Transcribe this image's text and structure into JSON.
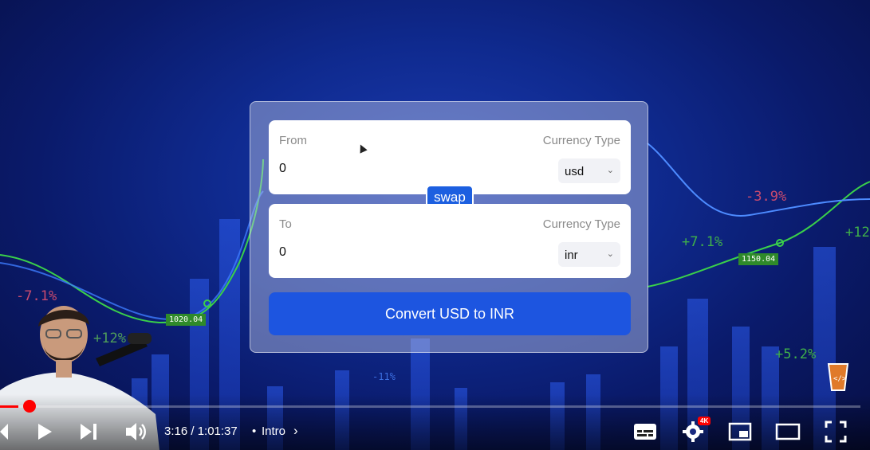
{
  "converter": {
    "from_label": "From",
    "from_currency_label": "Currency Type",
    "from_amount": "0",
    "from_currency": "usd",
    "swap_label": "swap",
    "to_label": "To",
    "to_currency_label": "Currency Type",
    "to_amount": "0",
    "to_currency": "inr",
    "convert_label": "Convert USD to INR"
  },
  "background": {
    "labels": [
      "-7.1%",
      "+12%",
      "+7.1%",
      "-3.9%",
      "+5.2%",
      "+12",
      "-11%"
    ],
    "price_tags": [
      "1020.04",
      "1150.04"
    ]
  },
  "player": {
    "time": "3:16 / 1:01:37",
    "separator": "•",
    "chapter": "Intro",
    "quality_badge": "4K",
    "progress_fraction": 0.053
  },
  "colors": {
    "accent": "#1d55e0",
    "progress": "#ff0000"
  },
  "icons": [
    "prev-icon",
    "play-icon",
    "next-icon",
    "volume-icon",
    "subtitles-icon",
    "settings-icon",
    "miniplayer-icon",
    "theater-icon",
    "fullscreen-icon",
    "channel-logo-icon"
  ]
}
